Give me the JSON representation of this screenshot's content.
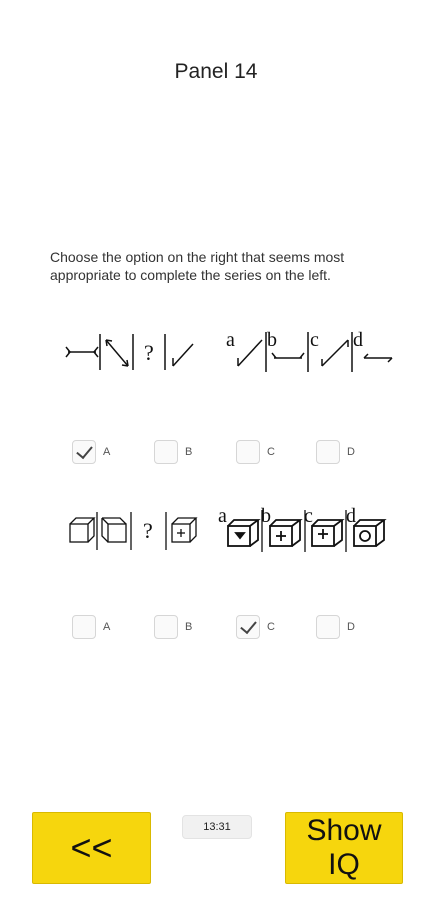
{
  "header": {
    "title": "Panel 14"
  },
  "instructions": "Choose the option on the right that seems most appropriate to complete the series on the left.",
  "puzzles": [
    {
      "question_mark": "?",
      "option_letters": [
        "a",
        "b",
        "c",
        "d"
      ],
      "answers": [
        {
          "label": "A",
          "checked": true
        },
        {
          "label": "B",
          "checked": false
        },
        {
          "label": "C",
          "checked": false
        },
        {
          "label": "D",
          "checked": false
        }
      ]
    },
    {
      "question_mark": "?",
      "option_letters": [
        "a",
        "b",
        "c",
        "d"
      ],
      "answers": [
        {
          "label": "A",
          "checked": false
        },
        {
          "label": "B",
          "checked": false
        },
        {
          "label": "C",
          "checked": true
        },
        {
          "label": "D",
          "checked": false
        }
      ]
    }
  ],
  "footer": {
    "back_label": "<<",
    "timer": "13:31",
    "iq_label_line1": "Show",
    "iq_label_line2": "IQ"
  }
}
